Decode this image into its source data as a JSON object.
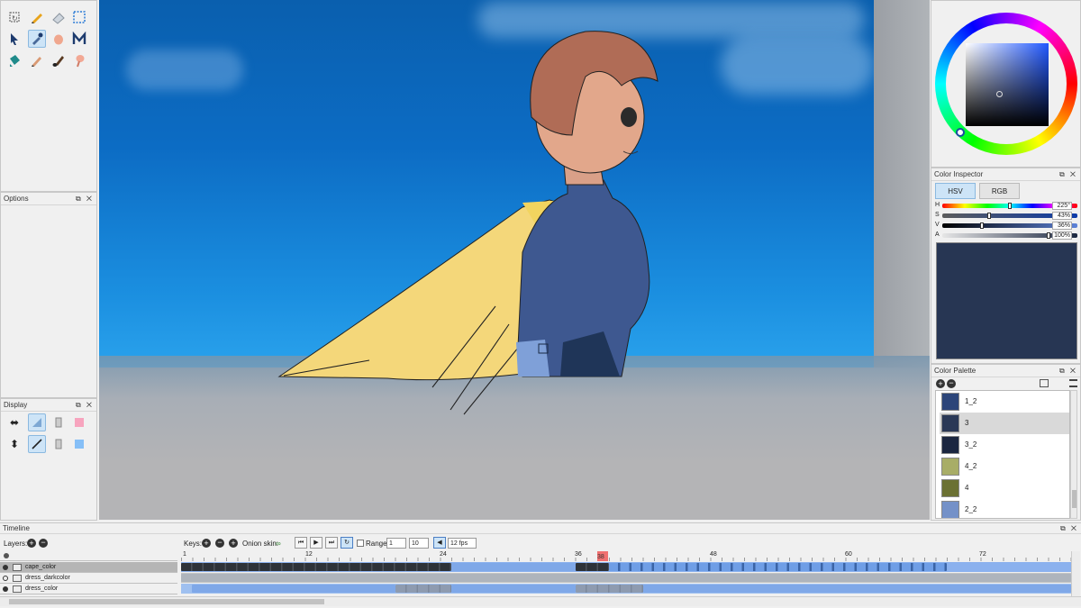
{
  "panels": {
    "options_title": "Options",
    "display_title": "Display",
    "color_inspector_title": "Color Inspector",
    "color_palette_title": "Color Palette",
    "timeline_title": "Timeline",
    "title_buttons": "⧉ ✕"
  },
  "tools": [
    {
      "name": "select-tool-icon"
    },
    {
      "name": "pencil-tool-icon"
    },
    {
      "name": "eraser-tool-icon"
    },
    {
      "name": "crop-tool-icon"
    },
    {
      "name": "pointer-tool-icon"
    },
    {
      "name": "eyedropper-tool-icon",
      "active": true
    },
    {
      "name": "hand-tool-icon"
    },
    {
      "name": "polyline-tool-icon"
    },
    {
      "name": "bucket-tool-icon"
    },
    {
      "name": "pen-tool-icon"
    },
    {
      "name": "brush-tool-icon"
    },
    {
      "name": "smudge-tool-icon"
    }
  ],
  "color_inspector": {
    "tab_hsv": "HSV",
    "tab_rgb": "RGB",
    "sliders": [
      {
        "label": "H",
        "value": "225°",
        "fraction": 0.625
      },
      {
        "label": "S",
        "value": "43%",
        "fraction": 0.43
      },
      {
        "label": "V",
        "value": "36%",
        "fraction": 0.36
      },
      {
        "label": "A",
        "value": "100%",
        "fraction": 1.0
      }
    ],
    "preview_color": "#273653"
  },
  "color_palette": {
    "items": [
      {
        "name": "1_2",
        "color": "#2c4579"
      },
      {
        "name": "3",
        "color": "#2a3856",
        "selected": true
      },
      {
        "name": "3_2",
        "color": "#1b2640"
      },
      {
        "name": "4_2",
        "color": "#a8ad67"
      },
      {
        "name": "4",
        "color": "#6b7133"
      },
      {
        "name": "2_2",
        "color": "#7491c8"
      }
    ]
  },
  "timeline": {
    "layers_label": "Layers:",
    "keys_label": "Keys:",
    "onion_label": "Onion skin:",
    "range_label": "Range",
    "range_start": "1",
    "range_end": "10",
    "fps": "12 fps",
    "frame_ticks": [
      "1",
      "12",
      "24",
      "36",
      "48",
      "60",
      "72"
    ],
    "current_frame": "38",
    "layers": [
      {
        "name": "cape_color",
        "selected": true
      },
      {
        "name": "dress_darkcolor",
        "selected": false
      },
      {
        "name": "dress_color",
        "selected": false
      }
    ]
  },
  "colors": {
    "accent_selection": "#cde4f7",
    "playhead": "#f07070",
    "key_dark": "#2d3238",
    "key_blue": "#7fa8e8"
  }
}
